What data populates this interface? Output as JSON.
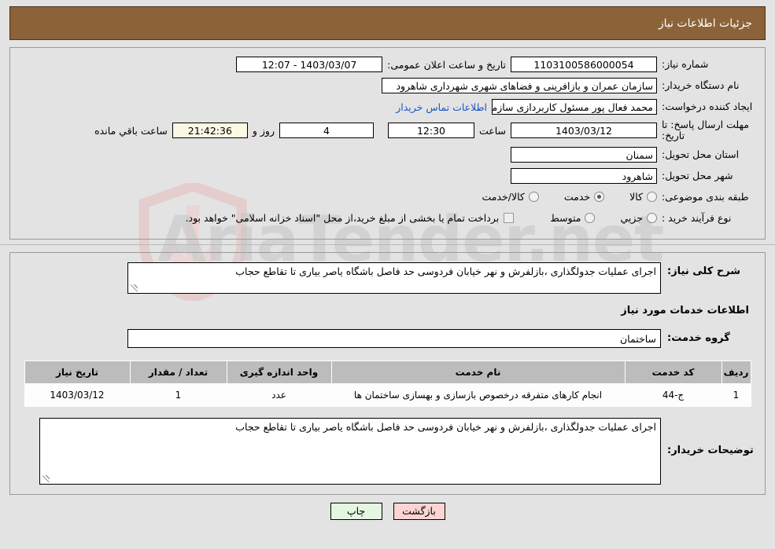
{
  "header": {
    "title": "جزئیات اطلاعات نیاز",
    "bar_color": "#8c6239"
  },
  "watermark": {
    "text": "AriaTender.net"
  },
  "info": {
    "need_number_label": "شماره نیاز:",
    "need_number_value": "1103100586000054",
    "public_announce_label": "تاریخ و ساعت اعلان عمومی:",
    "public_announce_value": "1403/03/07 - 12:07",
    "buyer_org_label": "نام دستگاه خریدار:",
    "buyer_org_value": "سازمان عمران و بازافرینی و فضاهای شهری شهرداری شاهرود",
    "creator_label": "ایجاد کننده درخواست:",
    "creator_value": "محمد فعال پور مسئول کاربردازی سازمان عمران و بازافرینی و فضاهای شهری ش",
    "contact_link": "اطلاعات تماس خریدار",
    "deadline_label": "مهلت ارسال پاسخ: تا تاریخ:",
    "deadline_date": "1403/03/12",
    "hour_label": "ساعت",
    "deadline_time": "12:30",
    "days_value": "4",
    "days_label": "روز و",
    "countdown_value": "21:42:36",
    "remaining_label": "ساعت باقي مانده",
    "province_label": "استان محل تحویل:",
    "province_value": "سمنان",
    "city_label": "شهر محل تحویل:",
    "city_value": "شاهرود",
    "category_label": "طبقه بندی موضوعی:",
    "category_options": [
      {
        "label": "کالا",
        "selected": false
      },
      {
        "label": "خدمت",
        "selected": true
      },
      {
        "label": "کالا/خدمت",
        "selected": false
      }
    ],
    "process_label": "نوع فرآیند خرید :",
    "process_options": [
      {
        "label": "جزیي",
        "selected": false
      },
      {
        "label": "متوسط",
        "selected": false
      }
    ],
    "treasury_checkbox_checked": false,
    "treasury_text": "برداخت تمام یا بخشی از مبلغ خرید،از محل \"اسناد خزانه اسلامی\" خواهد بود."
  },
  "details": {
    "general_desc_label": "شرح کلی نیاز:",
    "general_desc_value": "اجرای عملیات جدولگذاری ،بازلفرش و نهر خیابان فردوسی حد فاصل باشگاه یاصر بیاری تا تقاطع حجاب",
    "services_heading": "اطلاعات خدمات مورد نیاز",
    "service_group_label": "گروه خدمت:",
    "service_group_value": "ساختمان",
    "buyer_notes_label": "توضیحات خریدار:",
    "buyer_notes_value": "اجرای عملیات جدولگذاری ،بازلفرش و نهر خیابان فردوسی حد فاصل باشگاه یاصر بیاری تا تقاطع حجاب"
  },
  "table": {
    "headers": [
      "ردیف",
      "کد خدمت",
      "نام خدمت",
      "واحد اندازه گیری",
      "تعداد / مقدار",
      "تاریخ نیاز"
    ],
    "rows": [
      {
        "radif": "1",
        "code": "ج-44",
        "name": "انجام کارهای متفرقه درخصوص بازسازی و بهسازی ساختمان ها",
        "unit": "عدد",
        "qty": "1",
        "date": "1403/03/12"
      }
    ]
  },
  "footer": {
    "print_label": "چاپ",
    "back_label": "بازگشت"
  }
}
